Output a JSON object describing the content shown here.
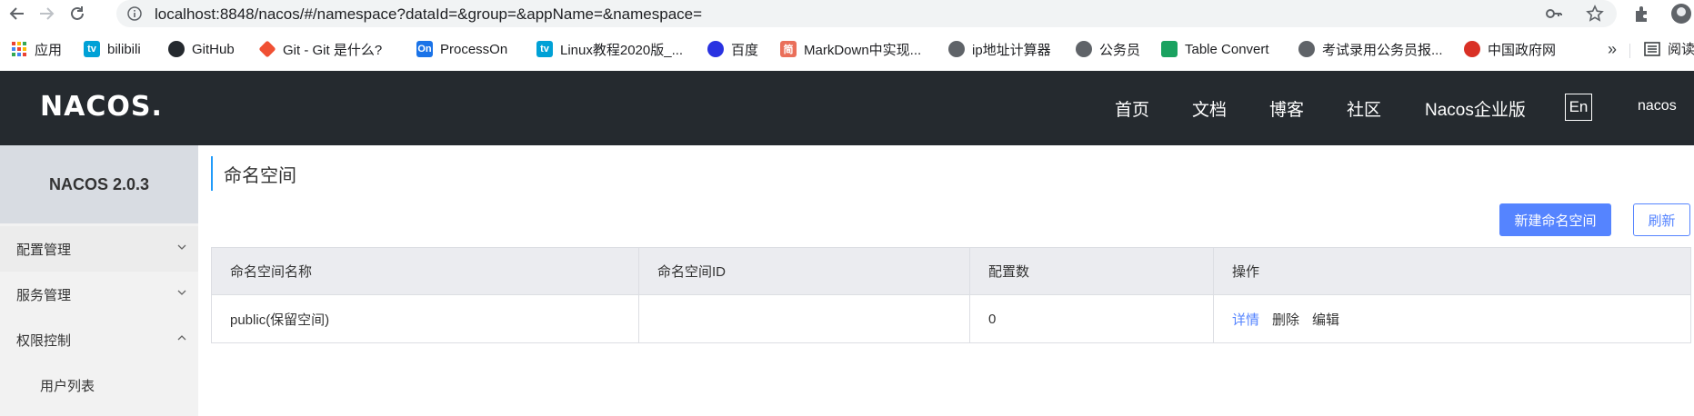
{
  "browser": {
    "url": "localhost:8848/nacos/#/namespace?dataId=&group=&appName=&namespace=",
    "bookmarks": [
      {
        "label": "应用",
        "icon": "apps-grid-icon"
      },
      {
        "label": "bilibili",
        "icon": "bilibili-icon"
      },
      {
        "label": "GitHub",
        "icon": "github-icon"
      },
      {
        "label": "Git - Git 是什么?",
        "icon": "git-icon"
      },
      {
        "label": "ProcessOn",
        "icon": "processon-icon",
        "icon_text": "On"
      },
      {
        "label": "Linux教程2020版_...",
        "icon": "bilibili-icon"
      },
      {
        "label": "百度",
        "icon": "baidu-paw-icon"
      },
      {
        "label": "MarkDown中实现...",
        "icon": "jianshu-icon",
        "icon_text": "简"
      },
      {
        "label": "ip地址计算器",
        "icon": "globe-icon"
      },
      {
        "label": "公务员",
        "icon": "globe-icon"
      },
      {
        "label": "Table Convert",
        "icon": "table-convert-icon"
      },
      {
        "label": "考试录用公务员报...",
        "icon": "globe-icon"
      },
      {
        "label": "中国政府网",
        "icon": "emblem-icon"
      }
    ],
    "more": "»",
    "reading_list": "阅读"
  },
  "header": {
    "logo": "NACOS.",
    "nav": [
      "首页",
      "文档",
      "博客",
      "社区",
      "Nacos企业版"
    ],
    "lang": "En",
    "user": "nacos"
  },
  "sidebar": {
    "title": "NACOS 2.0.3",
    "items": [
      {
        "label": "配置管理",
        "expanded": false
      },
      {
        "label": "服务管理",
        "expanded": false
      },
      {
        "label": "权限控制",
        "expanded": true
      }
    ],
    "sub_items": [
      "用户列表"
    ]
  },
  "main": {
    "title": "命名空间",
    "create_button": "新建命名空间",
    "refresh_button": "刷新",
    "table": {
      "headers": [
        "命名空间名称",
        "命名空间ID",
        "配置数",
        "操作"
      ],
      "rows": [
        {
          "name": "public(保留空间)",
          "id": "",
          "count": "0",
          "actions": [
            "详情",
            "删除",
            "编辑"
          ]
        }
      ]
    }
  },
  "colors": {
    "header_bg": "#252a2f",
    "primary": "#5584ff",
    "sidebar_bg": "#f2f2f2",
    "sidebar_title_bg": "#d8dce2"
  }
}
